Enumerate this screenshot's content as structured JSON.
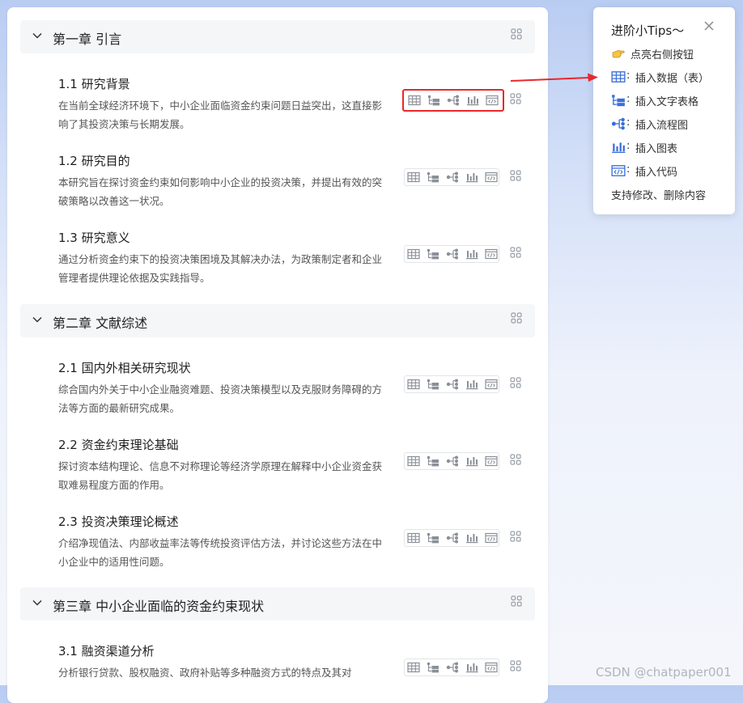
{
  "chapters": [
    {
      "title": "第一章 引言"
    },
    {
      "title": "第二章 文献综述"
    },
    {
      "title": "第三章 中小企业面临的资金约束现状"
    }
  ],
  "sections": [
    {
      "title": "1.1 研究背景",
      "desc": "在当前全球经济环境下，中小企业面临资金约束问题日益突出，这直接影响了其投资决策与长期发展。"
    },
    {
      "title": "1.2 研究目的",
      "desc": "本研究旨在探讨资金约束如何影响中小企业的投资决策，并提出有效的突破策略以改善这一状况。"
    },
    {
      "title": "1.3 研究意义",
      "desc": "通过分析资金约束下的投资决策困境及其解决办法，为政策制定者和企业管理者提供理论依据及实践指导。"
    },
    {
      "title": "2.1 国内外相关研究现状",
      "desc": "综合国内外关于中小企业融资难题、投资决策模型以及克服财务障碍的方法等方面的最新研究成果。"
    },
    {
      "title": "2.2 资金约束理论基础",
      "desc": "探讨资本结构理论、信息不对称理论等经济学原理在解释中小企业资金获取难易程度方面的作用。"
    },
    {
      "title": "2.3 投资决策理论概述",
      "desc": "介绍净现值法、内部收益率法等传统投资评估方法，并讨论这些方法在中小企业中的适用性问题。"
    },
    {
      "title": "3.1 融资渠道分析",
      "desc": "分析银行贷款、股权融资、政府补贴等多种融资方式的特点及其对"
    }
  ],
  "tips": {
    "title": "进阶小Tips～",
    "items": [
      {
        "label": "点亮右侧按钮",
        "icon": "pointing-hand-icon"
      },
      {
        "label": "插入数据（表）",
        "icon": "table-icon"
      },
      {
        "label": "插入文字表格",
        "icon": "text-table-icon"
      },
      {
        "label": "插入流程图",
        "icon": "flowchart-icon"
      },
      {
        "label": "插入图表",
        "icon": "bar-chart-icon"
      },
      {
        "label": "插入代码",
        "icon": "code-icon"
      }
    ],
    "colon": ":",
    "footer": "支持修改、删除内容"
  },
  "colors": {
    "accent": "#3a6fd8",
    "highlight": "#e8282c",
    "icon_gray": "#8a8f98"
  },
  "watermark": "CSDN @chatpaper001"
}
